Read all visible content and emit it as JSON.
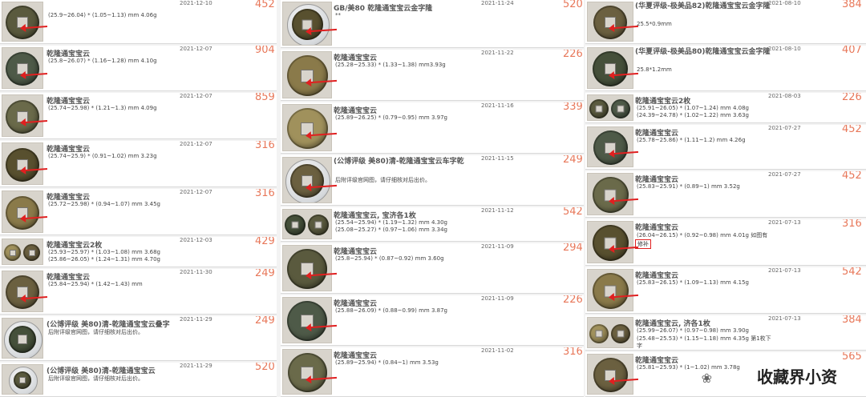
{
  "columns": [
    {
      "items": [
        {
          "title": "",
          "specs": [
            "(25.9~26.04) * (1.05~1.13) mm 4.06g"
          ],
          "date": "2021-12-10",
          "price": "452"
        },
        {
          "title": "乾隆通宝宝云",
          "specs": [
            "(25.8~26.07) * (1.16~1.28) mm 4.10g"
          ],
          "date": "2021-12-07",
          "price": "904"
        },
        {
          "title": "乾隆通宝宝云",
          "specs": [
            "(25.74~25.98) * (1.21~1.3) mm 4.09g"
          ],
          "date": "2021-12-07",
          "price": "859"
        },
        {
          "title": "乾隆通宝宝云",
          "specs": [
            "(25.74~25.9) * (0.91~1.02) mm 3.23g"
          ],
          "date": "2021-12-07",
          "price": "316"
        },
        {
          "title": "乾隆通宝宝云",
          "specs": [
            "(25.72~25.98) * (0.94~1.07) mm 3.45g"
          ],
          "date": "2021-12-07",
          "price": "316"
        },
        {
          "title": "乾隆通宝宝云2枚",
          "specs": [
            "(25.93~25.97) * (1.03~1.08) mm 3.68g",
            "(25.86~26.05) * (1.24~1.31) mm 4.70g"
          ],
          "date": "2021-12-03",
          "price": "429"
        },
        {
          "title": "乾隆通宝宝云",
          "specs": [
            "(25.84~25.94) * (1.42~1.43) mm"
          ],
          "date": "2021-11-30",
          "price": "249"
        },
        {
          "title": "(公博评级 美80)清-乾隆通宝宝云叠字",
          "specs": [
            "后附评级官网图，请仔细核对后出价。"
          ],
          "date": "2021-11-29",
          "price": "249"
        },
        {
          "title": "(公博评级 美80)清-乾隆通宝宝云",
          "specs": [
            "后附评级官网图，请仔细核对后出价。"
          ],
          "date": "2021-11-29",
          "price": "520"
        }
      ]
    },
    {
      "items": [
        {
          "title": "GB/美80 乾隆通宝宝云金字隆",
          "specs": [
            "**"
          ],
          "date": "2021-11-24",
          "price": "520"
        },
        {
          "title": "乾隆通宝宝云",
          "specs": [
            "(25.28~25.33) * (1.33~1.38) mm3.93g"
          ],
          "date": "2021-11-22",
          "price": "226"
        },
        {
          "title": "乾隆通宝宝云",
          "specs": [
            "(25.89~26.25) * (0.79~0.95) mm 3.97g"
          ],
          "date": "2021-11-16",
          "price": "339"
        },
        {
          "title": "(公博评级 美80)清-乾隆通宝宝云车字乾",
          "specs": [
            "后附评级官网图，请仔细核对后出价。"
          ],
          "date": "2021-11-15",
          "price": "249"
        },
        {
          "title": "乾隆通宝宝云, 宝济各1枚",
          "specs": [
            "(25.54~25.94) * (1.19~1.32) mm 4.30g",
            "(25.08~25.27) * (0.97~1.06) mm 3.34g"
          ],
          "date": "2021-11-12",
          "price": "542"
        },
        {
          "title": "乾隆通宝宝云",
          "specs": [
            "(25.8~25.94) * (0.87~0.92) mm 3.60g"
          ],
          "date": "2021-11-09",
          "price": "294"
        },
        {
          "title": "乾隆通宝宝云",
          "specs": [
            "(25.88~26.09) * (0.88~0.99) mm 3.87g"
          ],
          "date": "2021-11-09",
          "price": "226"
        },
        {
          "title": "乾隆通宝宝云",
          "specs": [
            "(25.89~25.94) * (0.84~1) mm 3.53g"
          ],
          "date": "2021-11-02",
          "price": "316"
        }
      ]
    },
    {
      "items": [
        {
          "title": "(华夏评级-极美品82)乾隆通宝宝云金字隆",
          "specs": [
            "25.5*0.9mm"
          ],
          "date": "2021-08-10",
          "price": "384"
        },
        {
          "title": "(华夏评级-极美品80)乾隆通宝宝云金字隆",
          "specs": [
            "25.8*1.2mm"
          ],
          "date": "2021-08-10",
          "price": "407"
        },
        {
          "title": "乾隆通宝宝云2枚",
          "specs": [
            "(25.91~26.05) * (1.07~1.24) mm 4.08g",
            "(24.39~24.78) * (1.02~1.22) mm 3.63g"
          ],
          "date": "2021-08-03",
          "price": "226"
        },
        {
          "title": "乾隆通宝宝云",
          "specs": [
            "(25.78~25.86) * (1.11~1.2) mm 4.26g"
          ],
          "date": "2021-07-27",
          "price": "452"
        },
        {
          "title": "乾隆通宝宝云",
          "specs": [
            "(25.83~25.91) * (0.89~1) mm 3.52g"
          ],
          "date": "2021-07-27",
          "price": "452"
        },
        {
          "title": "乾隆通宝宝云",
          "specs": [
            "(26.04~26.15) * (0.92~0.98) mm 4.01g 如图有"
          ],
          "note": "修补",
          "date": "2021-07-13",
          "price": "316"
        },
        {
          "title": "乾隆通宝宝云",
          "specs": [
            "(25.83~26.15) * (1.09~1.13) mm 4.15g"
          ],
          "date": "2021-07-13",
          "price": "542"
        },
        {
          "title": "乾隆通宝宝云, 济各1枚",
          "specs": [
            "(25.99~26.07) * (0.97~0.98) mm 3.90g",
            "(25.48~25.53) * (1.15~1.18) mm 4.35g 第1枚下",
            "字"
          ],
          "date": "2021-07-13",
          "price": "384"
        },
        {
          "title": "乾隆通宝宝云",
          "specs": [
            "(25.81~25.93) * (1~1.02) mm 3.78g"
          ],
          "date": "",
          "price": "565"
        }
      ]
    }
  ],
  "watermark": "收藏界小资",
  "colors": {
    "price": "#e8785a",
    "arrow": "#e02020",
    "border": "#d9d9d9"
  }
}
